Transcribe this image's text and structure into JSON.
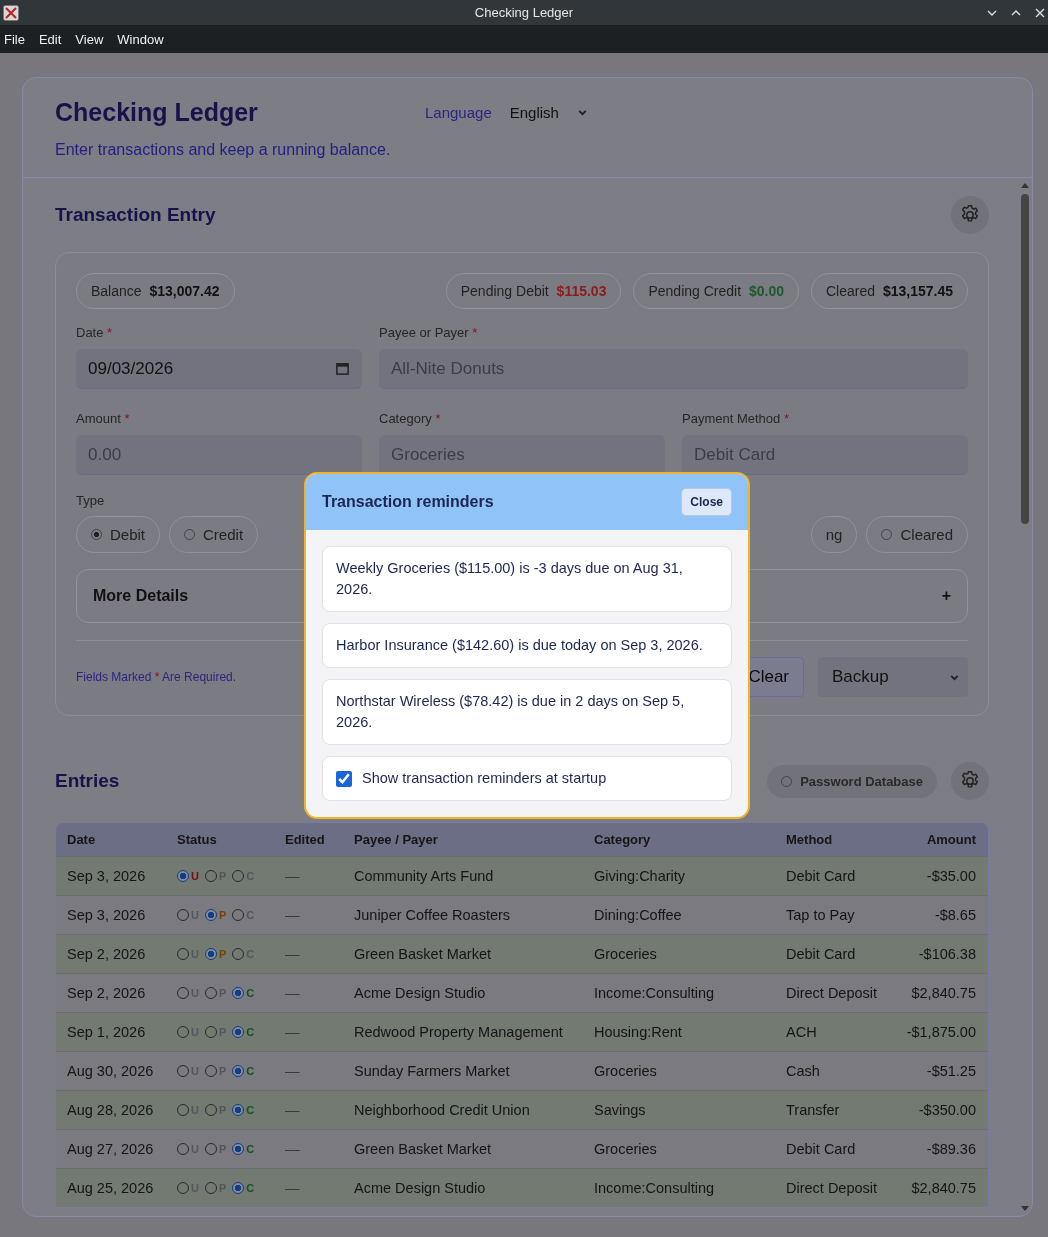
{
  "window": {
    "title": "Checking Ledger"
  },
  "menu": [
    "File",
    "Edit",
    "View",
    "Window"
  ],
  "header": {
    "title": "Checking Ledger",
    "subtitle": "Enter transactions and keep a running balance.",
    "language_label": "Language",
    "language": "English"
  },
  "entry": {
    "title": "Transaction Entry",
    "summary": [
      {
        "label": "Balance",
        "value": "$13,007.42",
        "color": "#111111"
      },
      {
        "label": "Pending Debit",
        "value": "$115.03",
        "color": "#8c1c1c"
      },
      {
        "label": "Pending Credit",
        "value": "$0.00",
        "color": "#1c5a28"
      },
      {
        "label": "Cleared",
        "value": "$13,157.45",
        "color": "#111111"
      }
    ],
    "fields": [
      {
        "label": "Date",
        "value": "09/03/2026",
        "kind": "date"
      },
      {
        "label": "Payee or Payer",
        "placeholder": "All-Nite Donuts",
        "kind": "text"
      },
      {
        "label": "Amount",
        "placeholder": "0.00",
        "kind": "text"
      },
      {
        "label": "Category",
        "placeholder": "Groceries",
        "kind": "text"
      },
      {
        "label": "Payment Method",
        "placeholder": "Debit Card",
        "kind": "text"
      }
    ],
    "type_label": "Type",
    "types": [
      {
        "label": "Debit",
        "selected": true
      },
      {
        "label": "Credit",
        "selected": false
      }
    ],
    "statuses": [
      {
        "label": "ng"
      },
      {
        "label": "Cleared",
        "selected": false
      }
    ],
    "more_details": "More Details",
    "expand": "+",
    "required_note": {
      "before": "Fields Marked",
      "mark": "*",
      "after": "Are Required."
    },
    "clear": "Clear",
    "backup": "Backup"
  },
  "entries": {
    "title": "Entries",
    "filter": {
      "label": "Password Database",
      "selected": false
    },
    "columns": [
      "Date",
      "Status",
      "Edited",
      "Payee / Payer",
      "Category",
      "Method",
      "Amount"
    ],
    "rows": [
      {
        "date": "Sep 3, 2026",
        "status": [
          {
            "label": "U",
            "selected": true
          },
          {
            "label": "P",
            "selected": false
          },
          {
            "label": "C",
            "selected": false
          }
        ],
        "edited": "—",
        "payee": "Community Arts Fund",
        "category": "Giving:Charity",
        "method": "Debit Card",
        "amount": "-$35.00"
      },
      {
        "date": "Sep 3, 2026",
        "status": [
          {
            "label": "U",
            "selected": false
          },
          {
            "label": "P",
            "selected": true
          },
          {
            "label": "C",
            "selected": false
          }
        ],
        "edited": "—",
        "payee": "Juniper Coffee Roasters",
        "category": "Dining:Coffee",
        "method": "Tap to Pay",
        "amount": "-$8.65"
      },
      {
        "date": "Sep 2, 2026",
        "status": [
          {
            "label": "U",
            "selected": false
          },
          {
            "label": "P",
            "selected": true
          },
          {
            "label": "C",
            "selected": false
          }
        ],
        "edited": "—",
        "payee": "Green Basket Market",
        "category": "Groceries",
        "method": "Debit Card",
        "amount": "-$106.38"
      },
      {
        "date": "Sep 2, 2026",
        "status": [
          {
            "label": "U",
            "selected": false
          },
          {
            "label": "P",
            "selected": false
          },
          {
            "label": "C",
            "selected": true
          }
        ],
        "edited": "—",
        "payee": "Acme Design Studio",
        "category": "Income:Consulting",
        "method": "Direct Deposit",
        "amount": "$2,840.75"
      },
      {
        "date": "Sep 1, 2026",
        "status": [
          {
            "label": "U",
            "selected": false
          },
          {
            "label": "P",
            "selected": false
          },
          {
            "label": "C",
            "selected": true
          }
        ],
        "edited": "—",
        "payee": "Redwood Property Management",
        "category": "Housing:Rent",
        "method": "ACH",
        "amount": "-$1,875.00"
      },
      {
        "date": "Aug 30, 2026",
        "status": [
          {
            "label": "U",
            "selected": false
          },
          {
            "label": "P",
            "selected": false
          },
          {
            "label": "C",
            "selected": true
          }
        ],
        "edited": "—",
        "payee": "Sunday Farmers Market",
        "category": "Groceries",
        "method": "Cash",
        "amount": "-$51.25"
      },
      {
        "date": "Aug 28, 2026",
        "status": [
          {
            "label": "U",
            "selected": false
          },
          {
            "label": "P",
            "selected": false
          },
          {
            "label": "C",
            "selected": true
          }
        ],
        "edited": "—",
        "payee": "Neighborhood Credit Union",
        "category": "Savings",
        "method": "Transfer",
        "amount": "-$350.00"
      },
      {
        "date": "Aug 27, 2026",
        "status": [
          {
            "label": "U",
            "selected": false
          },
          {
            "label": "P",
            "selected": false
          },
          {
            "label": "C",
            "selected": true
          }
        ],
        "edited": "—",
        "payee": "Green Basket Market",
        "category": "Groceries",
        "method": "Debit Card",
        "amount": "-$89.36"
      },
      {
        "date": "Aug 25, 2026",
        "status": [
          {
            "label": "U",
            "selected": false
          },
          {
            "label": "P",
            "selected": false
          },
          {
            "label": "C",
            "selected": true
          }
        ],
        "edited": "—",
        "payee": "Acme Design Studio",
        "category": "Income:Consulting",
        "method": "Direct Deposit",
        "amount": "$2,840.75"
      }
    ]
  },
  "dialog": {
    "title": "Transaction reminders",
    "close": "Close",
    "reminders": [
      "Weekly Groceries ($115.00) is -3 days due on Aug 31, 2026.",
      "Harbor Insurance ($142.60) is due today on Sep 3, 2026.",
      "Northstar Wireless ($78.42) is due in 2 days on Sep 5, 2026."
    ],
    "startup": {
      "label": "Show transaction reminders at startup",
      "checked": true
    }
  }
}
